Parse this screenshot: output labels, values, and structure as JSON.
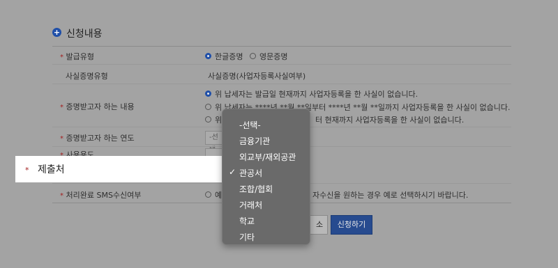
{
  "section": {
    "title": "신청내용"
  },
  "rows": {
    "issue_type": {
      "label": "발급유형",
      "options": [
        "한글증명",
        "영문증명"
      ],
      "selected": "한글증명"
    },
    "cert_type": {
      "label": "사실증명유형",
      "value": "사실증명(사업자등록사실여부)"
    },
    "content": {
      "label": "증명받고자 하는 내용",
      "options": [
        "위 납세자는 발급일 현재까지 사업자등록을 한 사실이 없습니다.",
        "위 납세자는 ****년 **월 **일부터 ****년 **월 **일까지 사업자등록을 한 사실이 없습니다.",
        "위 납세자는 ****년 **월 **일부터 현재까지 사업자등록을 한 사실이 없습니다."
      ],
      "option_visible_tails": [
        "위 납세자는 ****년 **월 **일부터 ****년 **월 **일까지 사업자등록을 한 사실이 없습니다.",
        "터 현재까지 사업자등록을 한 사실이 없습니다."
      ]
    },
    "year": {
      "label": "증명받고자 하는 연도",
      "placeholder": "-선택"
    },
    "usage": {
      "label": "사용용도"
    },
    "submit_to": {
      "label": "제출처"
    },
    "sms": {
      "label": "처리완료 SMS수신여부",
      "option_head": "예",
      "note_tail": "자수신을 원하는 경우 예로 선택하시기 바랍니다."
    }
  },
  "dropdown": {
    "items": [
      "-선택-",
      "금융기관",
      "외교부/재외공관",
      "관공서",
      "조합/협회",
      "거래처",
      "학교",
      "기타"
    ],
    "selected": "관공서",
    "check_glyph": "✓"
  },
  "buttons": {
    "cancel_tail": "소",
    "apply": "신청하기"
  },
  "colors": {
    "accent": "#1f4fa8",
    "required": "#a31f1f",
    "overlay": "#a3a3a3"
  }
}
